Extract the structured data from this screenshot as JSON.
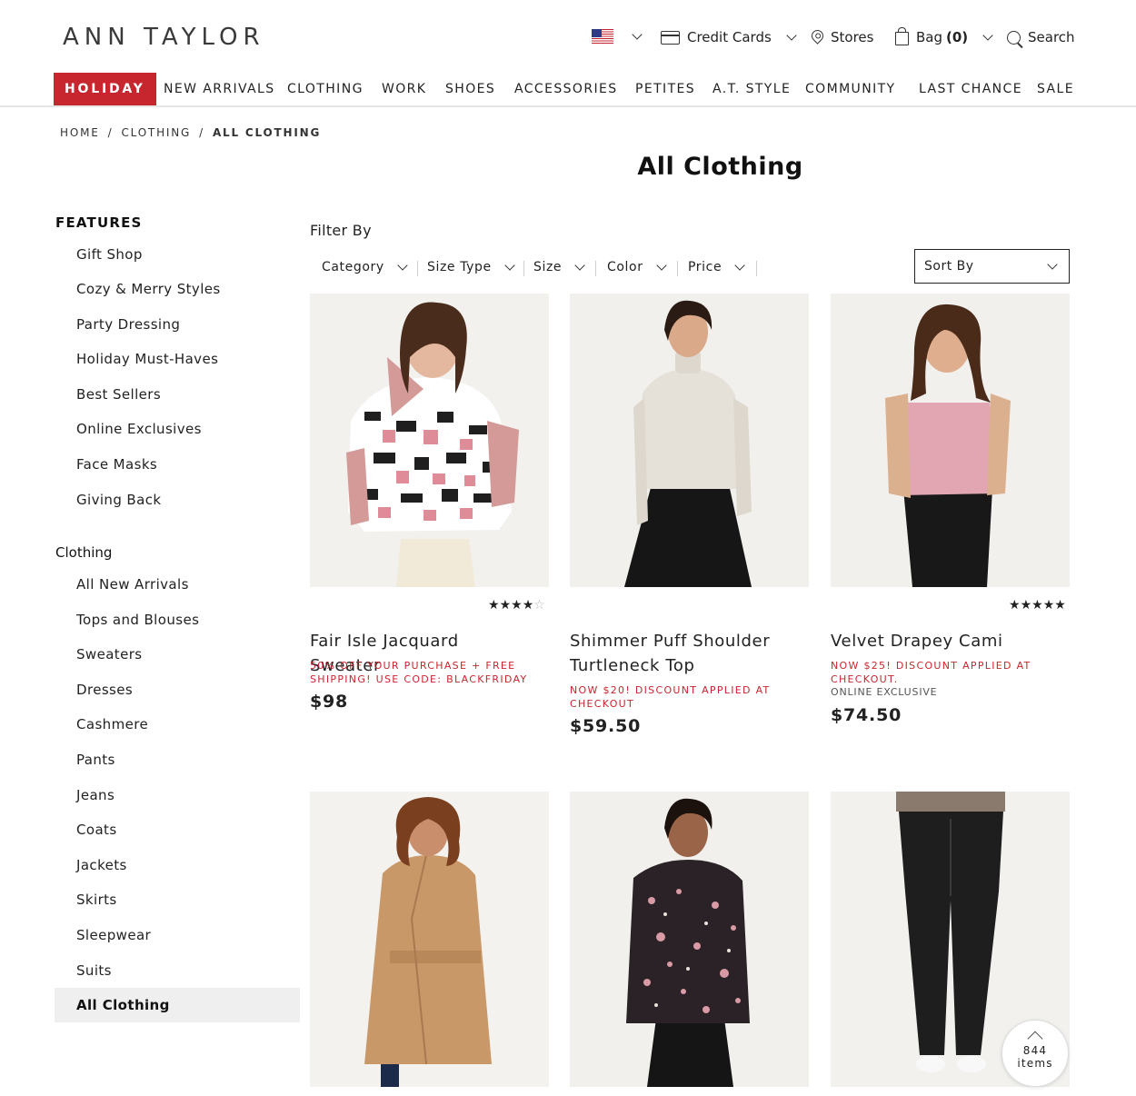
{
  "brand": {
    "logo": "ANN TAYLOR"
  },
  "utility": {
    "credit_cards": "Credit Cards",
    "stores": "Stores",
    "bag_label": "Bag",
    "bag_count": "(0)",
    "search": "Search"
  },
  "nav": {
    "items": [
      "HOLIDAY",
      "NEW ARRIVALS",
      "CLOTHING",
      "WORK",
      "SHOES",
      "ACCESSORIES",
      "PETITES",
      "A.T. STYLE",
      "COMMUNITY",
      "LAST CHANCE",
      "SALE"
    ],
    "active_index": 0
  },
  "breadcrumb": {
    "items": [
      "HOME",
      "CLOTHING",
      "ALL CLOTHING"
    ],
    "separator": "/"
  },
  "page_title": "All Clothing",
  "sidebar": {
    "features_heading": "FEATURES",
    "features": [
      "Gift Shop",
      "Cozy & Merry Styles",
      "Party Dressing",
      "Holiday Must-Haves",
      "Best Sellers",
      "Online Exclusives",
      "Face Masks",
      "Giving Back"
    ],
    "clothing_heading": "Clothing",
    "clothing": [
      "All New Arrivals",
      "Tops and Blouses",
      "Sweaters",
      "Dresses",
      "Cashmere",
      "Pants",
      "Jeans",
      "Coats",
      "Jackets",
      "Skirts",
      "Sleepwear",
      "Suits",
      "All Clothing"
    ],
    "selected": "All Clothing"
  },
  "filters": {
    "label": "Filter By",
    "items": [
      "Category",
      "Size Type",
      "Size",
      "Color",
      "Price"
    ],
    "sort_label": "Sort By"
  },
  "products": [
    {
      "name": "Fair Isle Jacquard Sweater",
      "promo": "50% OFF YOUR PURCHASE + FREE SHIPPING! USE CODE: BLACKFRIDAY",
      "price": "$98",
      "rating": 4,
      "rating_max": 5
    },
    {
      "name": "Shimmer Puff Shoulder Turtleneck Top",
      "promo": "NOW $20! DISCOUNT APPLIED AT CHECKOUT",
      "price": "$59.50"
    },
    {
      "name": "Velvet Drapey Cami",
      "promo": "NOW $25! DISCOUNT APPLIED AT CHECKOUT.",
      "exclusive": "ONLINE EXCLUSIVE",
      "price": "$74.50",
      "rating": 5,
      "rating_max": 5
    }
  ],
  "items_badge": {
    "count": "844",
    "unit": "items"
  },
  "colors": {
    "accent": "#c7262e",
    "selected_bg": "#efefef"
  }
}
